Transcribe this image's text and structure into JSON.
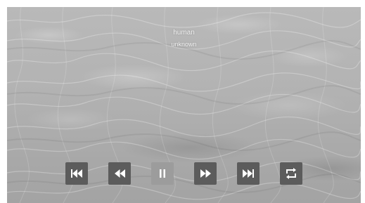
{
  "track": {
    "title": "human",
    "artist": "unknown"
  },
  "controls": [
    {
      "name": "skip-previous-button",
      "icon": "skip-previous-icon"
    },
    {
      "name": "rewind-button",
      "icon": "rewind-icon"
    },
    {
      "name": "pause-button",
      "icon": "pause-icon"
    },
    {
      "name": "fast-forward-button",
      "icon": "fast-forward-icon"
    },
    {
      "name": "skip-next-button",
      "icon": "skip-next-icon"
    },
    {
      "name": "repeat-button",
      "icon": "repeat-icon"
    }
  ],
  "colors": {
    "button_background": "#5c5c5c",
    "active_button_background": "#9c9c9c",
    "icon": "#ffffff",
    "text": "#f2f2f2"
  }
}
